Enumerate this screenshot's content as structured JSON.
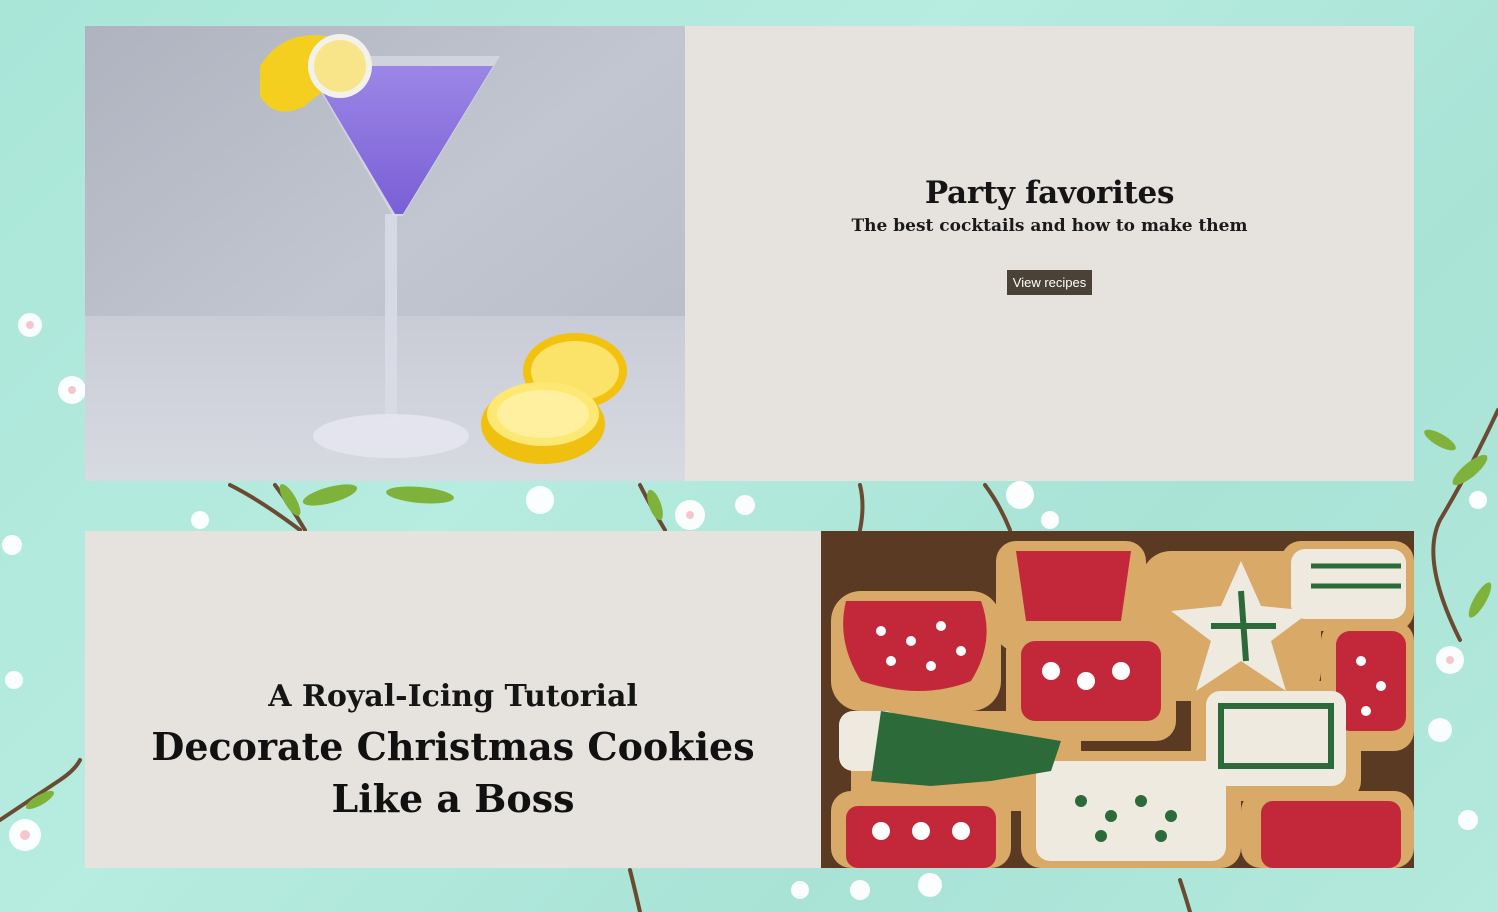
{
  "colors": {
    "background": "#aee7da",
    "card": "#e6e3df",
    "button": "#4a4236",
    "button_text": "#ffffff"
  },
  "feature_cocktails": {
    "image": "purple-martini-with-lemon-photo",
    "title": "Party favorites",
    "subtitle": "The best cocktails and how to make them",
    "button_label": "View recipes"
  },
  "feature_cookies": {
    "image": "decorated-christmas-cookies-photo",
    "kicker": "A Royal-Icing Tutorial",
    "title": "Decorate Christmas Cookies Like a Boss"
  }
}
